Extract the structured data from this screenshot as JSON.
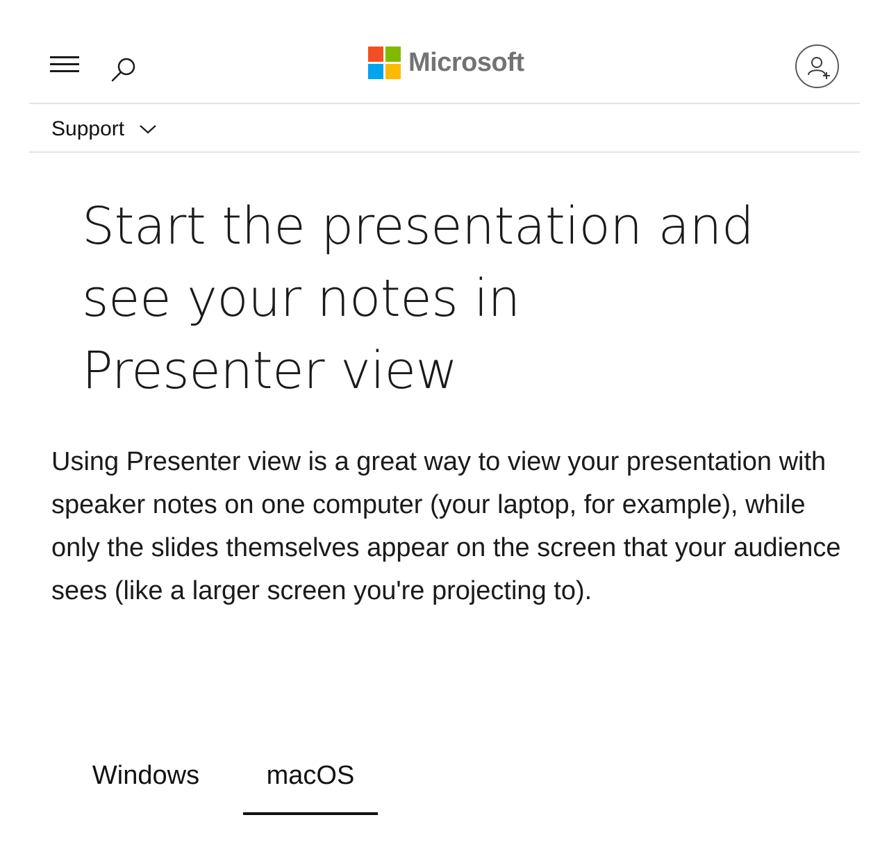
{
  "header": {
    "menu_icon": "hamburger-menu-icon",
    "search_icon": "search-icon",
    "brand": "Microsoft",
    "brand_colors": [
      "#f25022",
      "#7fba00",
      "#00a4ef",
      "#ffb900"
    ],
    "account_icon": "add-account-icon"
  },
  "nav": {
    "support_label": "Support",
    "support_icon": "chevron-down-icon"
  },
  "main": {
    "title": "Start the presentation and see your notes in Presenter view",
    "intro": "Using Presenter view is a great way to view your presentation with speaker notes on one computer (your laptop, for example), while only the slides themselves appear on the screen that your audience sees (like a larger screen you're projecting to).",
    "tabs": [
      {
        "label": "Windows",
        "selected": false
      },
      {
        "label": "macOS",
        "selected": true
      }
    ]
  }
}
